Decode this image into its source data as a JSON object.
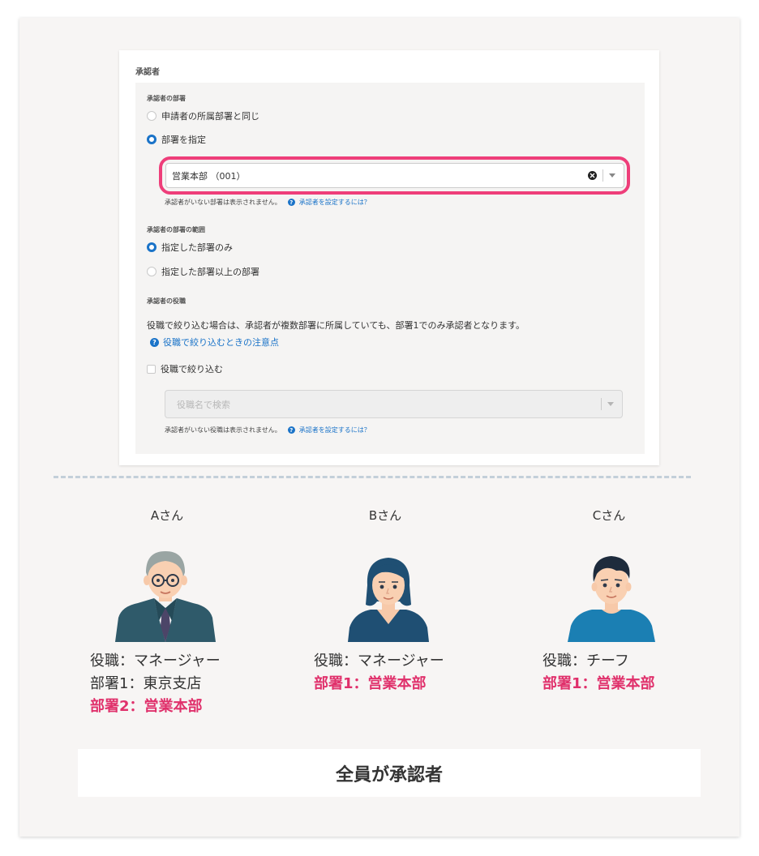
{
  "card": {
    "title": "承認者",
    "dept_section_label": "承認者の部署",
    "radio_same_as_applicant": "申請者の所属部署と同じ",
    "radio_specify_dept": "部署を指定",
    "dept_select_value": "営業本部 （001）",
    "dept_help_text": "承認者がいない部署は表示されません。",
    "dept_help_link": "承認者を設定するには？",
    "range_section_label": "承認者の部署の範囲",
    "radio_only_specified": "指定した部署のみ",
    "radio_specified_and_above": "指定した部署以上の部署",
    "role_section_label": "承認者の役職",
    "role_description": "役職で絞り込む場合は、承認者が複数部署に所属していても、部署1でのみ承認者となります。",
    "role_notes_link": "役職で絞り込むときの注意点",
    "role_filter_checkbox": "役職で絞り込む",
    "role_search_placeholder": "役職名で検索",
    "role_help_text": "承認者がいない役職は表示されません。",
    "role_help_link": "承認者を設定するには？"
  },
  "people": [
    {
      "name": "Aさん",
      "lines": [
        "役職：マネージャー",
        "部署1：東京支店"
      ],
      "highlight": "部署2：営業本部"
    },
    {
      "name": "Bさん",
      "lines": [
        "役職：マネージャー"
      ],
      "highlight": "部署1：営業本部"
    },
    {
      "name": "Cさん",
      "lines": [
        "役職：チーフ"
      ],
      "highlight": "部署1：営業本部"
    }
  ],
  "result_text": "全員が承認者",
  "colors": {
    "accent_blue": "#1a73c8",
    "highlight_pink": "#ee3e7a",
    "text_pink": "#e0306b"
  }
}
